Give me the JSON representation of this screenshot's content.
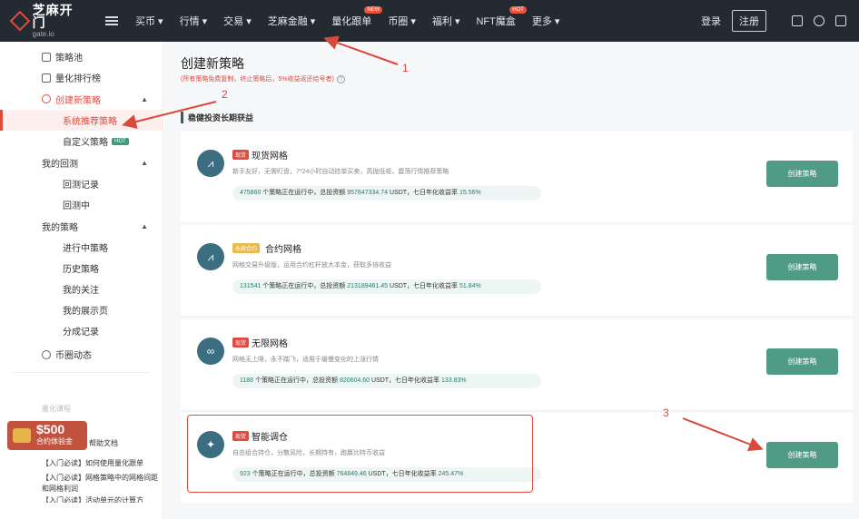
{
  "topbar": {
    "logo_cn": "芝麻开门",
    "logo_en": "gate.io",
    "nav": [
      {
        "label": "买币 ▾"
      },
      {
        "label": "行情 ▾"
      },
      {
        "label": "交易 ▾"
      },
      {
        "label": "芝麻金融 ▾"
      },
      {
        "label": "量化跟单",
        "badge": "NEW"
      },
      {
        "label": "币圈 ▾"
      },
      {
        "label": "福利 ▾"
      },
      {
        "label": "NFT魔盒",
        "badge": "HOT"
      },
      {
        "label": "更多 ▾"
      }
    ],
    "login": "登录",
    "register": "注册"
  },
  "sidebar": {
    "strategy_pool": "策略池",
    "quant_rank": "量化排行榜",
    "create_strategy": "创建新策略",
    "system_recommend": "系统推荐策略",
    "custom_strategy": "自定义策略",
    "custom_badge": "HOT",
    "my_backtest": "我的回测",
    "backtest_record": "回测记录",
    "backtesting": "回测中",
    "my_strategy": "我的策略",
    "running": "进行中策略",
    "history": "历史策略",
    "my_follow": "我的关注",
    "my_showcase": "我的展示页",
    "share_record": "分成记录",
    "coin_news": "币圈动态",
    "faded_text": "量化课程",
    "promo_amount": "$500",
    "promo_label": "合约体验金",
    "help_docs": "帮助文档",
    "guides": [
      "【入门必读】如何使用量化跟单",
      "【入门必读】网格策略中的网格间距和网格利润",
      "【入门必读】活动单元的计算方"
    ]
  },
  "main": {
    "title": "创建新策略",
    "subtitle": "(所有策略免费复制，终止策略后，5%收益返还给号者)",
    "section": "稳健投资长期获益",
    "create_label": "创建策略",
    "cards": [
      {
        "tag": "现货",
        "name": "现货网格",
        "desc": "新手友好，无需盯盘，7*24小时自动挂单买卖，高抛低吸，震荡行情推荐策略",
        "count": "475860",
        "stat_mid": " 个策略正在运行中，总投资额 ",
        "amount": "957847334.74",
        "stat_tail": " USDT，七日年化收益率 ",
        "rate": "15.56%",
        "icon": "chart-icon"
      },
      {
        "tag": "永续合约",
        "name": "合约网格",
        "desc": "网格交易升级版，运用合约杠杆放大本金，获取多倍收益",
        "count": "131541",
        "stat_mid": " 个策略正在运行中，总投资额 ",
        "amount": "213189461.45",
        "stat_tail": " USDT，七日年化收益率 ",
        "rate": "51.84%",
        "icon": "chart-icon"
      },
      {
        "tag": "现货",
        "name": "无限网格",
        "desc": "网格无上限，永不踏飞，适用于缓慢变化的上涨行情",
        "count": "1188",
        "stat_mid": " 个策略正在运行中，总投资额 ",
        "amount": "820604.60",
        "stat_tail": " USDT，七日年化收益率 ",
        "rate": "133.83%",
        "icon": "infinity-icon"
      },
      {
        "tag": "现货",
        "name": "智能调仓",
        "desc": "自由组合持仓，分散风险，长期持有，跑赢比特币收益",
        "count": "923",
        "stat_mid": " 个策略正在运行中，总投资额 ",
        "amount": "764849.46",
        "stat_tail": " USDT，七日年化收益率 ",
        "rate": "245.47%",
        "icon": "bulb-icon"
      }
    ]
  },
  "annotations": {
    "n1": "1",
    "n2": "2",
    "n3": "3"
  }
}
